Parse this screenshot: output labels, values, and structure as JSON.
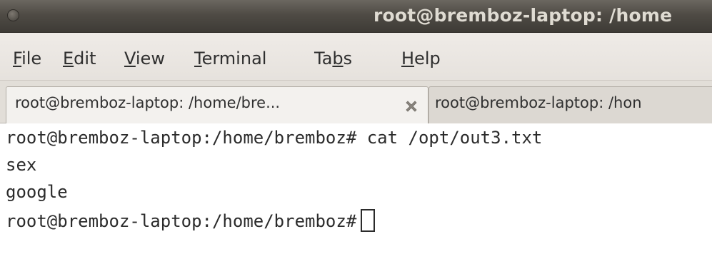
{
  "window": {
    "title": "root@bremboz-laptop: /home"
  },
  "menu": {
    "file": {
      "pre": "",
      "mnemonic": "F",
      "post": "ile"
    },
    "edit": {
      "pre": "",
      "mnemonic": "E",
      "post": "dit"
    },
    "view": {
      "pre": "",
      "mnemonic": "V",
      "post": "iew"
    },
    "terminal": {
      "pre": "",
      "mnemonic": "T",
      "post": "erminal"
    },
    "tabs": {
      "pre": "Ta",
      "mnemonic": "b",
      "post": "s"
    },
    "help": {
      "pre": "",
      "mnemonic": "H",
      "post": "elp"
    }
  },
  "tabs": [
    {
      "label": "root@bremboz-laptop: /home/bre...",
      "active": true
    },
    {
      "label": "root@bremboz-laptop: /hon",
      "active": false
    }
  ],
  "terminal": {
    "lines": [
      "root@bremboz-laptop:/home/bremboz# cat /opt/out3.txt",
      "sex",
      "google"
    ],
    "prompt": "root@bremboz-laptop:/home/bremboz#"
  },
  "colors": {
    "titlebar": "#4f4b45",
    "title_text": "#dfdbd2",
    "menubar": "#ebe7e2",
    "terminal_bg": "#ffffff",
    "terminal_text": "#2b2b2b"
  },
  "icons": {
    "window_close": "close-circle-icon",
    "tab_close": "x-close-icon"
  }
}
